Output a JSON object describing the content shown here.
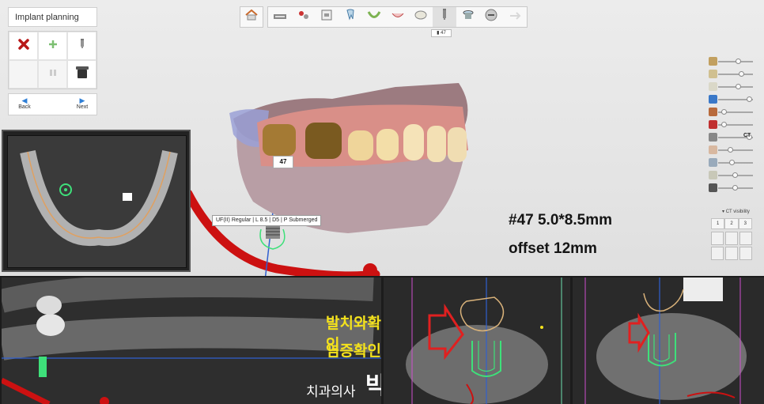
{
  "panel": {
    "title": "Implant planning",
    "back_label": "Back",
    "next_label": "Next"
  },
  "toolbar": {
    "steps": [
      "scan-icon",
      "tools-icon",
      "ct-icon",
      "tooth-icon",
      "arch-icon",
      "mouth-icon",
      "crown-icon",
      "implant-icon",
      "sleeve-icon",
      "surgical-guide-icon",
      "finish-icon"
    ],
    "active_badge": "47"
  },
  "visibility": {
    "ct_label": "CT",
    "ct_visibility_label": "CT visibility",
    "layout_tabs": [
      "1",
      "2",
      "3"
    ],
    "sliders": [
      0.55,
      0.65,
      0.55,
      0.9,
      0.1,
      0.1,
      0.9,
      0.3,
      0.35,
      0.45,
      0.45
    ]
  },
  "scene": {
    "tooth_number": "47",
    "implant_label": "UF(II) Regular | L 8.5 | D5 | P Submerged"
  },
  "annotation": {
    "line1": "#47 5.0*8.5mm",
    "line2": "offset 12mm"
  },
  "notes": {
    "line1": "발치와확인",
    "line2": "염증확인",
    "signature_small": "치과의사",
    "signature_big": "박 현성"
  },
  "colors": {
    "accent_blue": "#2f7fd6",
    "delete_red": "#b81818",
    "nerve_red": "#cc1111",
    "implant_green": "#3ee07a",
    "note_yellow": "#f4e21c"
  }
}
